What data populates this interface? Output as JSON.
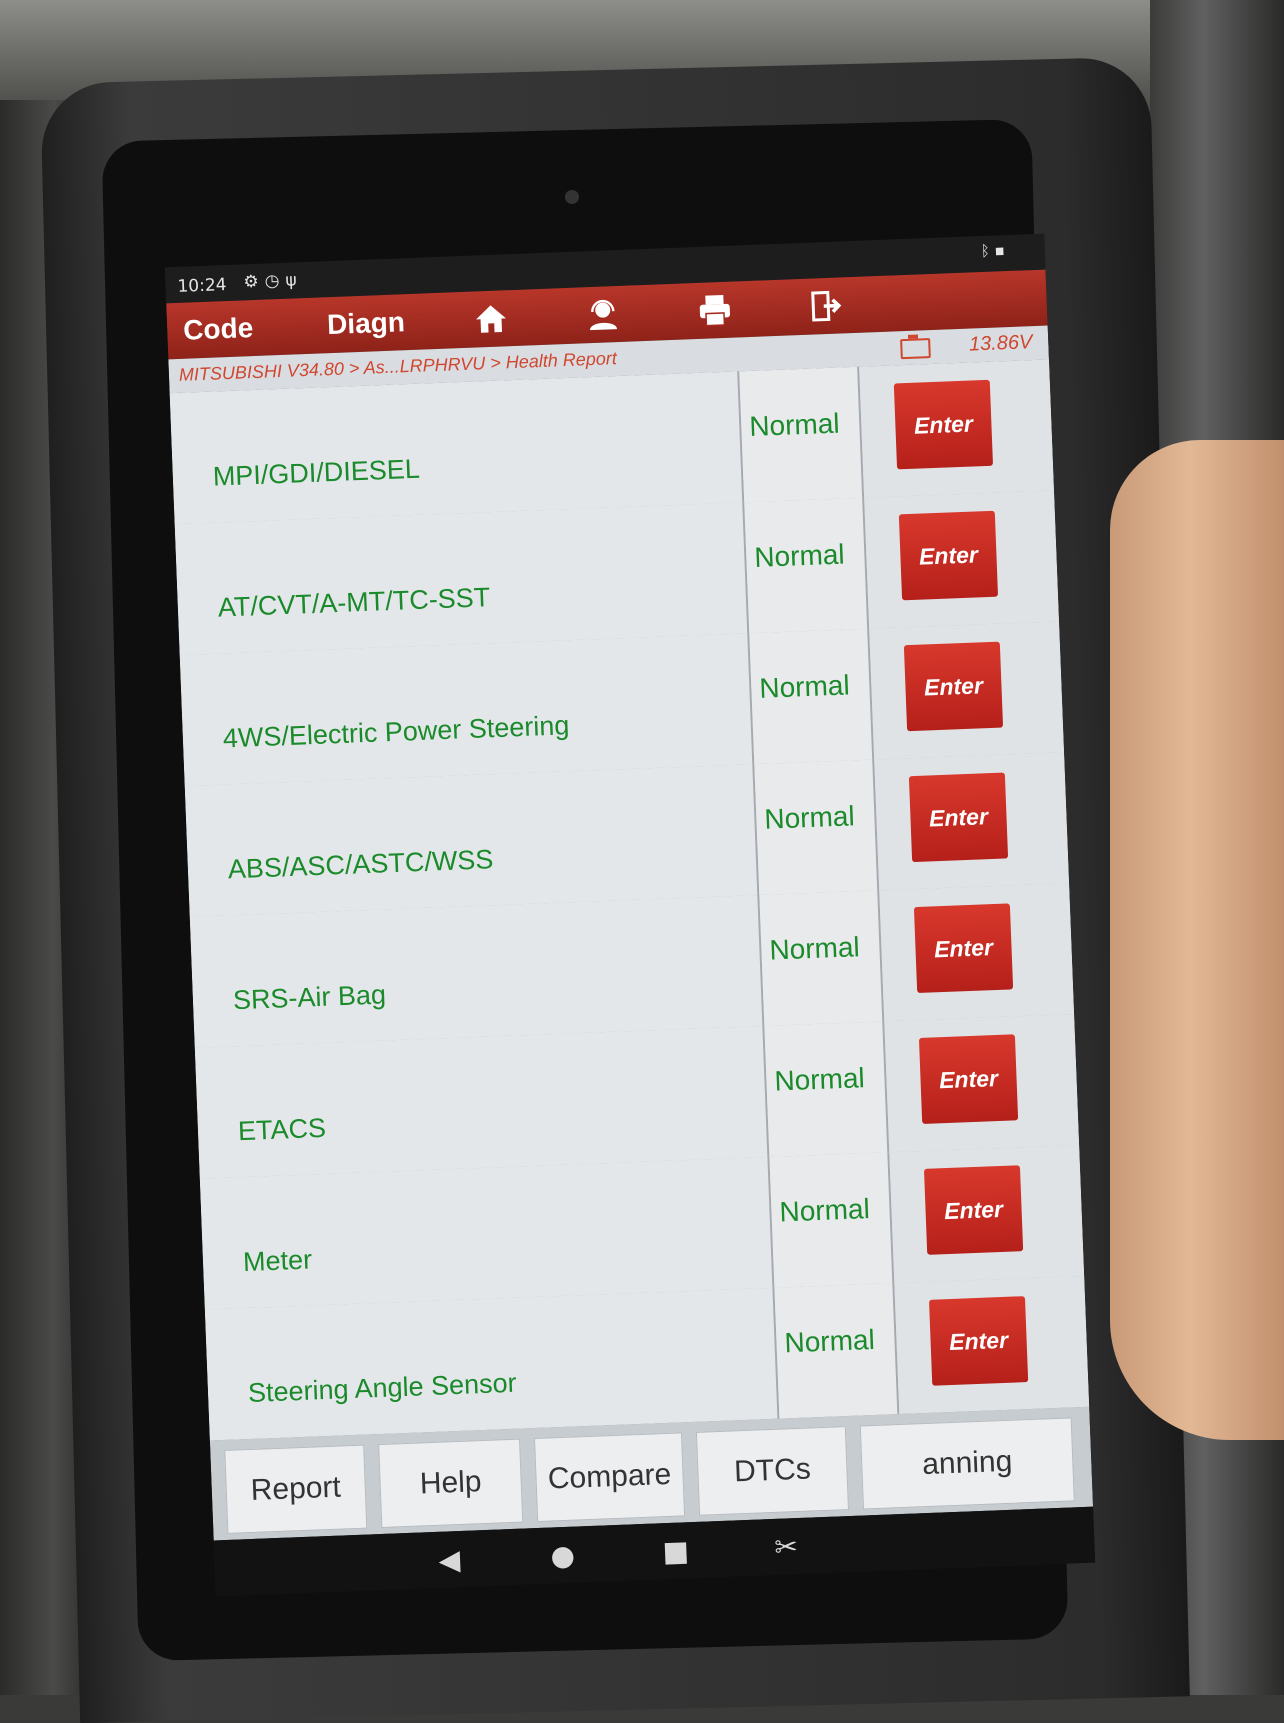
{
  "status_bar": {
    "time": "10:24",
    "icons": [
      "gear-icon",
      "clock-icon",
      "usb-icon",
      "bluetooth-icon"
    ]
  },
  "toolbar": {
    "tabs": [
      "Code",
      "Diagn"
    ],
    "icons": [
      "home-icon",
      "support-icon",
      "print-icon",
      "exit-icon"
    ],
    "color": "#a52a1f"
  },
  "breadcrumb": {
    "path": "MITSUBISHI V34.80 > As...LRPHRVU > Health Report",
    "voltage": "13.86V"
  },
  "systems": [
    {
      "name": "MPI/GDI/DIESEL",
      "status": "Normal",
      "action": "Enter"
    },
    {
      "name": "AT/CVT/A-MT/TC-SST",
      "status": "Normal",
      "action": "Enter"
    },
    {
      "name": "4WS/Electric Power Steering",
      "status": "Normal",
      "action": "Enter"
    },
    {
      "name": "ABS/ASC/ASTC/WSS",
      "status": "Normal",
      "action": "Enter"
    },
    {
      "name": "SRS-Air Bag",
      "status": "Normal",
      "action": "Enter"
    },
    {
      "name": "ETACS",
      "status": "Normal",
      "action": "Enter"
    },
    {
      "name": "Meter",
      "status": "Normal",
      "action": "Enter"
    },
    {
      "name": "Steering Angle Sensor",
      "status": "Normal",
      "action": "Enter"
    }
  ],
  "bottom_buttons": [
    "Report",
    "Help",
    "Compare",
    "DTCs",
    "anning"
  ],
  "nav_bar": [
    "back-icon",
    "home-circle-icon",
    "recents-icon",
    "screenshot-icon"
  ]
}
